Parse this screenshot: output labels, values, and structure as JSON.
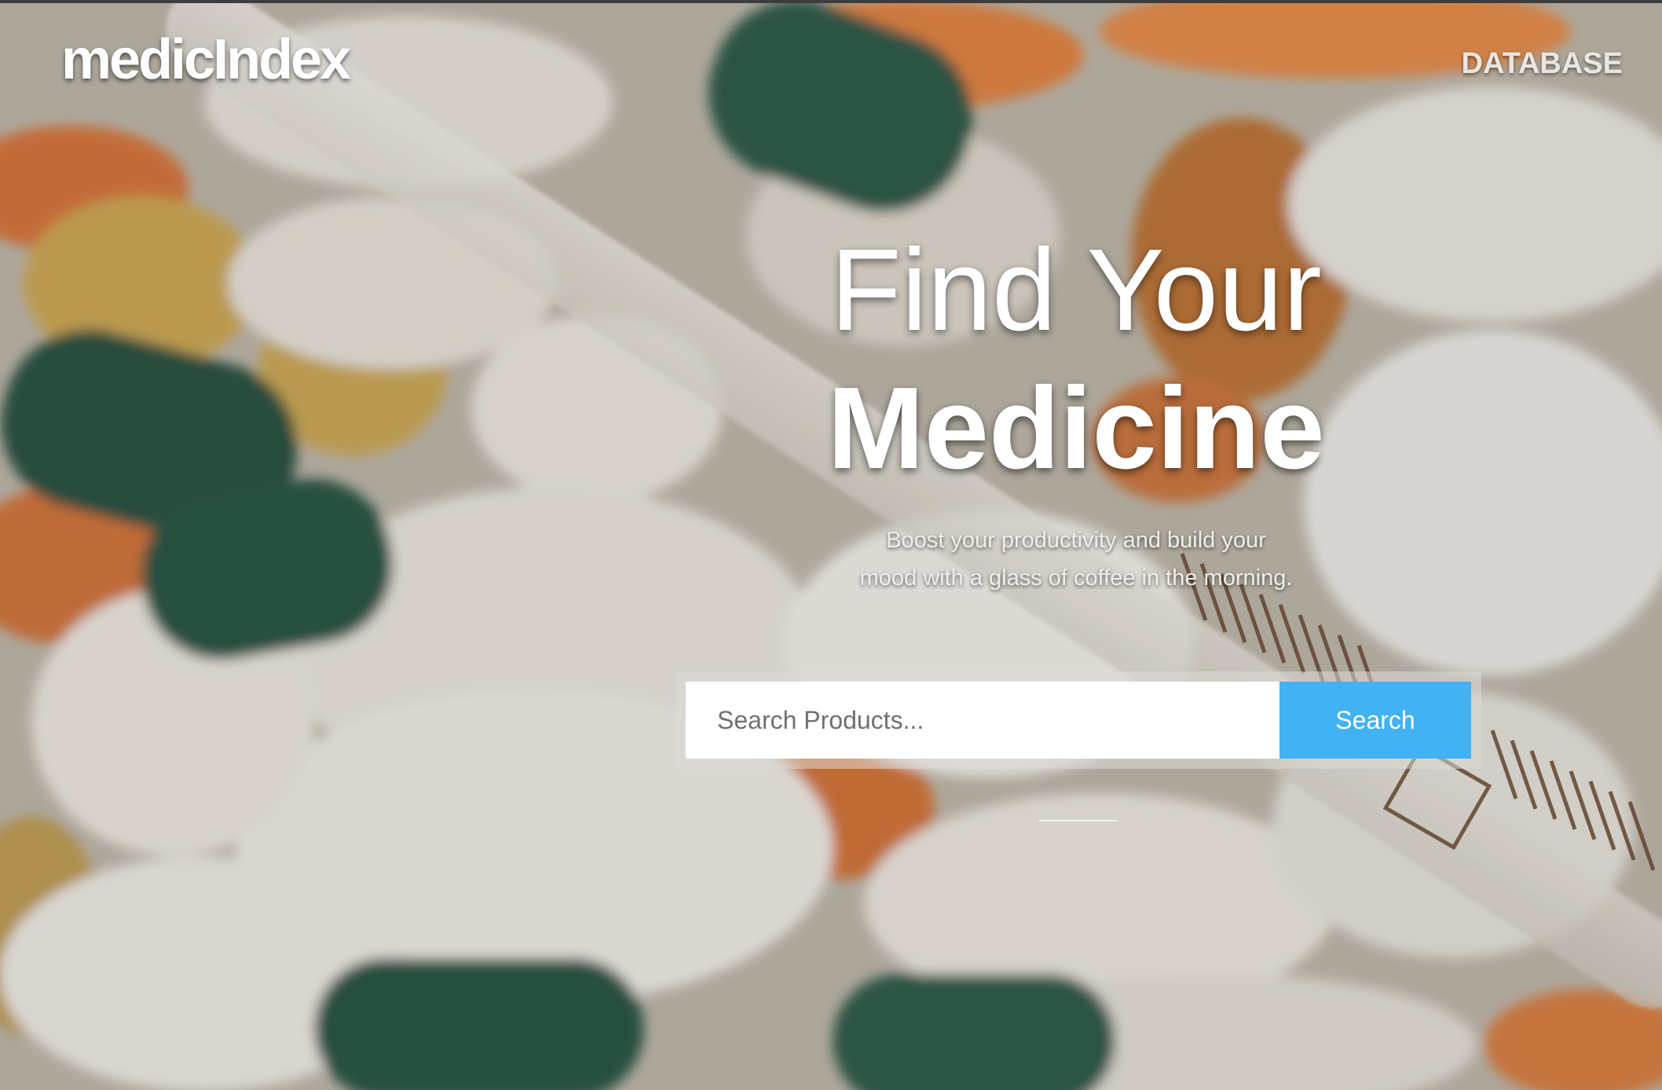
{
  "brand": {
    "logo_text": "medicIndex"
  },
  "nav": {
    "database_label": "DATABASE"
  },
  "hero": {
    "title_line1": "Find Your",
    "title_line2": "Medicine",
    "subtitle_line1": "Boost your productivity and build your",
    "subtitle_line2": "mood with a glass of coffee in the morning."
  },
  "search": {
    "placeholder": "Search Products...",
    "button_label": "Search"
  },
  "colors": {
    "accent": "#42b2f5",
    "text": "#ffffff"
  }
}
